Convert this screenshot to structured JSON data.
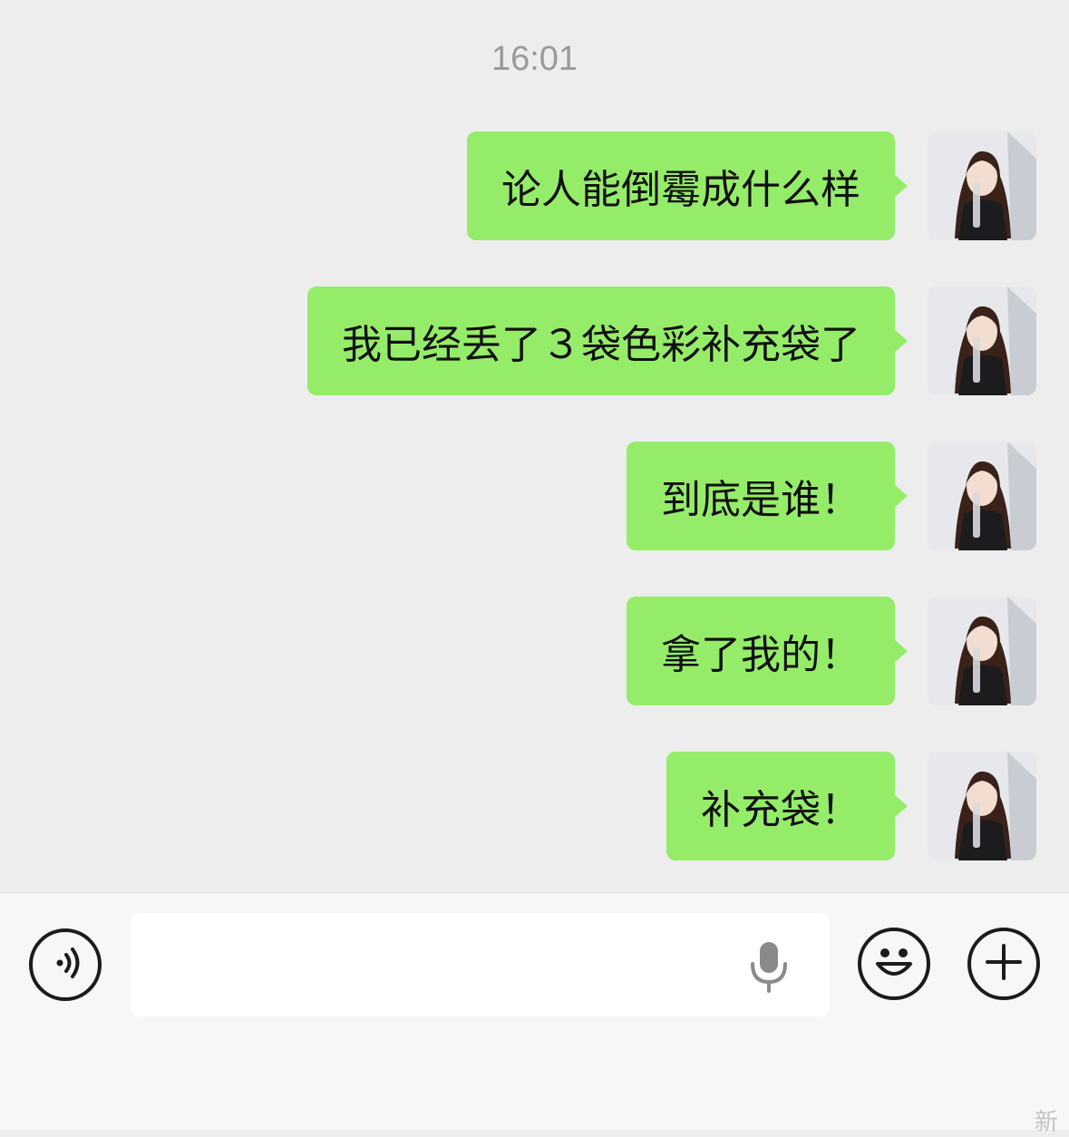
{
  "chat": {
    "timestamp": "16:01",
    "messages": [
      {
        "text": "论人能倒霉成什么样",
        "sender": "me"
      },
      {
        "text": "我已经丢了３袋色彩补充袋了",
        "sender": "me"
      },
      {
        "text": "到底是谁！",
        "sender": "me"
      },
      {
        "text": "拿了我的！",
        "sender": "me"
      },
      {
        "text": "补充袋！",
        "sender": "me"
      }
    ]
  },
  "input_bar": {
    "placeholder": "",
    "icons": [
      "voice-icon",
      "microphone-icon",
      "emoji-icon",
      "plus-icon"
    ]
  },
  "watermark": "新",
  "colors": {
    "bubble": "#95ec69",
    "chat_bg": "#ededed",
    "input_bar_bg": "#f7f7f7"
  }
}
